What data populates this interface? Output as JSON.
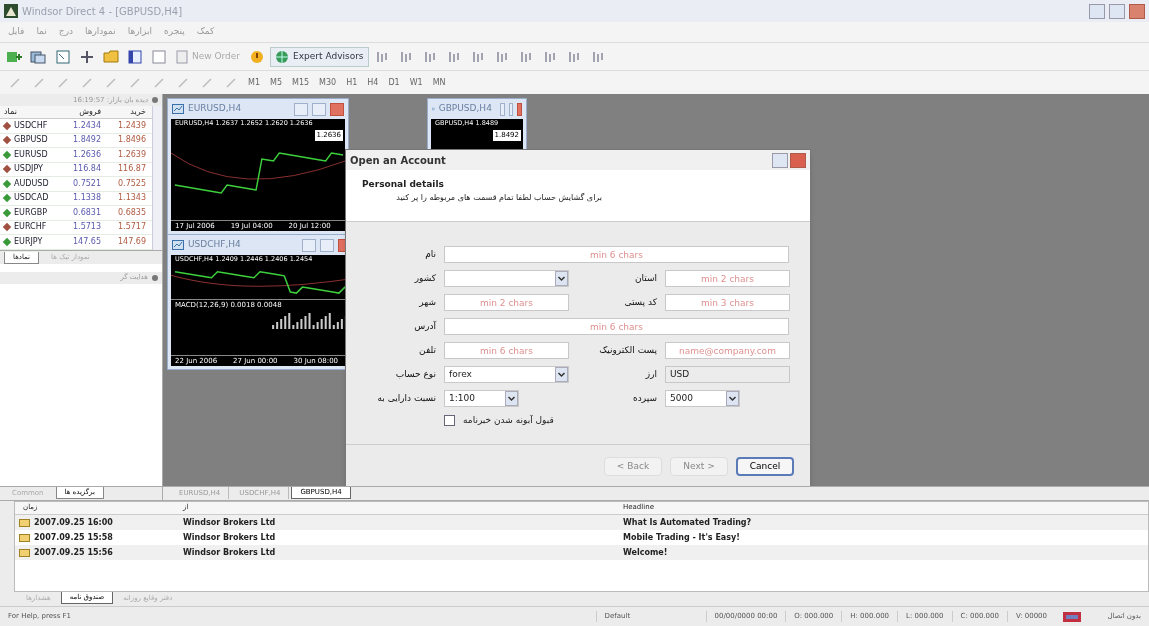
{
  "window": {
    "title": "Windsor Direct 4 - [GBPUSD,H4]"
  },
  "menu": [
    "کمک",
    "پنجره",
    "ابزارها",
    "نمودارها",
    "درج",
    "نما",
    "فایل"
  ],
  "toolbar": {
    "new_order": "New Order",
    "expert_advisors": "Expert Advisors"
  },
  "timeframes": [
    "M1",
    "M5",
    "M15",
    "M30",
    "H1",
    "H4",
    "D1",
    "W1",
    "MN"
  ],
  "market_watch": {
    "title": "دیده بان بازار: 16:19:57",
    "symbol_header": "نماد",
    "bid_header": "فروش",
    "ask_header": "خرید",
    "rows": [
      {
        "symbol": "USDCHF",
        "bid": "1.2434",
        "ask": "1.2439",
        "color": "#a05040"
      },
      {
        "symbol": "GBPUSD",
        "bid": "1.8492",
        "ask": "1.8496",
        "color": "#a05040"
      },
      {
        "symbol": "EURUSD",
        "bid": "1.2636",
        "ask": "1.2639",
        "color": "#3a9a3a"
      },
      {
        "symbol": "USDJPY",
        "bid": "116.84",
        "ask": "116.87",
        "color": "#a05040"
      },
      {
        "symbol": "AUDUSD",
        "bid": "0.7521",
        "ask": "0.7525",
        "color": "#3a9a3a"
      },
      {
        "symbol": "USDCAD",
        "bid": "1.1338",
        "ask": "1.1343",
        "color": "#3a9a3a"
      },
      {
        "symbol": "EURGBP",
        "bid": "0.6831",
        "ask": "0.6835",
        "color": "#3a9a3a"
      },
      {
        "symbol": "EURCHF",
        "bid": "1.5713",
        "ask": "1.5717",
        "color": "#a05040"
      },
      {
        "symbol": "EURJPY",
        "bid": "147.65",
        "ask": "147.69",
        "color": "#3a9a3a"
      }
    ],
    "tabs": [
      {
        "label": "نمودار تیک ها",
        "selected": false
      },
      {
        "label": "نمادها",
        "selected": true
      }
    ]
  },
  "navigator": {
    "title": "هدایت گر",
    "tabs": [
      {
        "label": "Common",
        "selected": false
      },
      {
        "label": "برگزیده ها",
        "selected": true
      }
    ]
  },
  "charts": [
    {
      "title": "EURUSD,H4",
      "header": "EURUSD,H4 1.2637 1.2652 1.2620 1.2636",
      "price": "1.2636",
      "dates": [
        "17 Jul 2006",
        "19 Jul 04:00",
        "20 Jul 12:00"
      ]
    },
    {
      "title": "GBPUSD,H4",
      "header": "GBPUSD,H4 1.8489",
      "price": "1.8492"
    },
    {
      "title": "USDCHF,H4",
      "header": "USDCHF,H4 1.2409 1.2446 1.2406 1.2454",
      "indicator": "MACD(12,26,9) 0.0018 0.0048",
      "dates": [
        "22 Jun 2006",
        "27 Jun 00:00",
        "30 Jun 08:00"
      ]
    }
  ],
  "chart_tabs": [
    {
      "label": "EURUSD,H4",
      "selected": false
    },
    {
      "label": "USDCHF,H4",
      "selected": false
    },
    {
      "label": "GBPUSD,H4",
      "selected": true
    }
  ],
  "dialog": {
    "title": "Open an Account",
    "heading": "Personal details",
    "subtitle": "برای گشایش حساب لطفا تمام قسمت های مربوطه را پر کنید",
    "name": {
      "label": "نام",
      "placeholder": "min 6 chars"
    },
    "country": {
      "label": "کشور"
    },
    "state": {
      "label": "استان",
      "placeholder": "min 2 chars"
    },
    "city": {
      "label": "شهر",
      "placeholder": "min 2 chars"
    },
    "zip": {
      "label": "کد پستی",
      "placeholder": "min 3 chars"
    },
    "address": {
      "label": "آدرس",
      "placeholder": "min 6 chars"
    },
    "phone": {
      "label": "تلفن",
      "placeholder": "min 6 chars"
    },
    "email": {
      "label": "پست الکترونیک",
      "placeholder": "name@company.com"
    },
    "account_type": {
      "label": "نوع حساب",
      "value": "forex"
    },
    "currency": {
      "label": "ارز",
      "value": "USD",
      "disabled": true
    },
    "leverage": {
      "label": "نسبت دارایی به",
      "value": "1:100"
    },
    "deposit": {
      "label": "سپرده",
      "value": "5000"
    },
    "newsletter": {
      "label": "قبول آبونه شدن خبرنامه",
      "checked": false
    },
    "buttons": [
      {
        "label": "< Back",
        "disabled": true
      },
      {
        "label": "Next >",
        "disabled": true
      },
      {
        "label": "Cancel",
        "disabled": false
      }
    ]
  },
  "news": {
    "time_header": "زمان",
    "from_header": "از",
    "headline_header": "Headline",
    "rows": [
      {
        "time": "2007.09.25 16:00",
        "from": "Windsor Brokers Ltd",
        "headline": "What Is Automated Trading?"
      },
      {
        "time": "2007.09.25 15:58",
        "from": "Windsor Brokers Ltd",
        "headline": "Mobile Trading - It's Easy!"
      },
      {
        "time": "2007.09.25 15:56",
        "from": "Windsor Brokers Ltd",
        "headline": "Welcome!"
      }
    ],
    "tabs": [
      {
        "label": "دفتر وقایع روزانه",
        "selected": false
      },
      {
        "label": "صندوق نامه",
        "selected": true
      },
      {
        "label": "هشدارها",
        "selected": false
      }
    ]
  },
  "status_bar": {
    "help": "For Help, press F1",
    "profile": "Default",
    "datetime": "00/00/0000 00:00",
    "open": "O: 000.000",
    "high": "H: 000.000",
    "low": "L: 000.000",
    "close": "C: 000.000",
    "volume": "V: 00000",
    "connection": "بدون اتصال"
  }
}
